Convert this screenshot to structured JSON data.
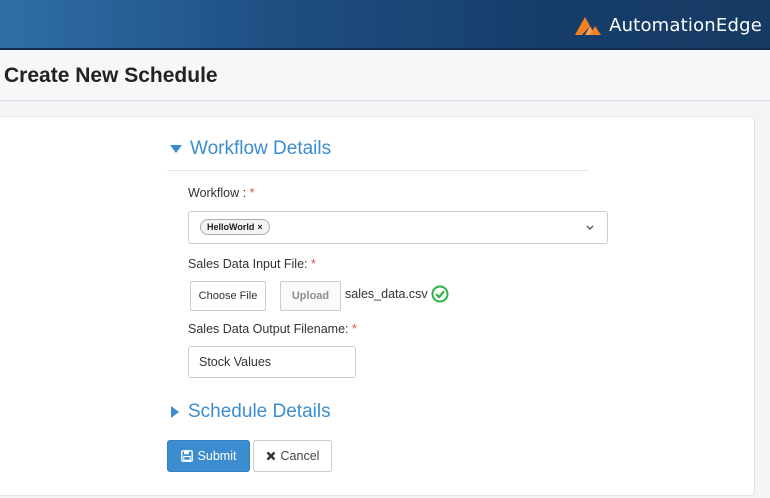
{
  "header": {
    "brand_name": "AutomationEdge",
    "brand_color": "#f58220",
    "bar_color": "#1e4f83"
  },
  "page": {
    "title": "Create New Schedule"
  },
  "workflow_details": {
    "heading": "Workflow Details",
    "expanded": true,
    "workflow": {
      "label": "Workflow : ",
      "required_mark": "*",
      "selected_tag": "HelloWorld",
      "tag_remove": "×"
    },
    "input_file": {
      "label": "Sales Data Input File: ",
      "required_mark": "*",
      "choose_label": "Choose File",
      "upload_label": "Upload",
      "file_name": "sales_data.csv",
      "status_icon": "check-circle-icon"
    },
    "output_file": {
      "label": "Sales Data Output Filename: ",
      "required_mark": "*",
      "value": "Stock Values"
    }
  },
  "schedule_details": {
    "heading": "Schedule Details",
    "expanded": false
  },
  "actions": {
    "submit_label": "Submit",
    "cancel_label": "Cancel"
  },
  "colors": {
    "accent": "#3c8dcf",
    "required": "#d9534f",
    "success": "#2fb344"
  }
}
